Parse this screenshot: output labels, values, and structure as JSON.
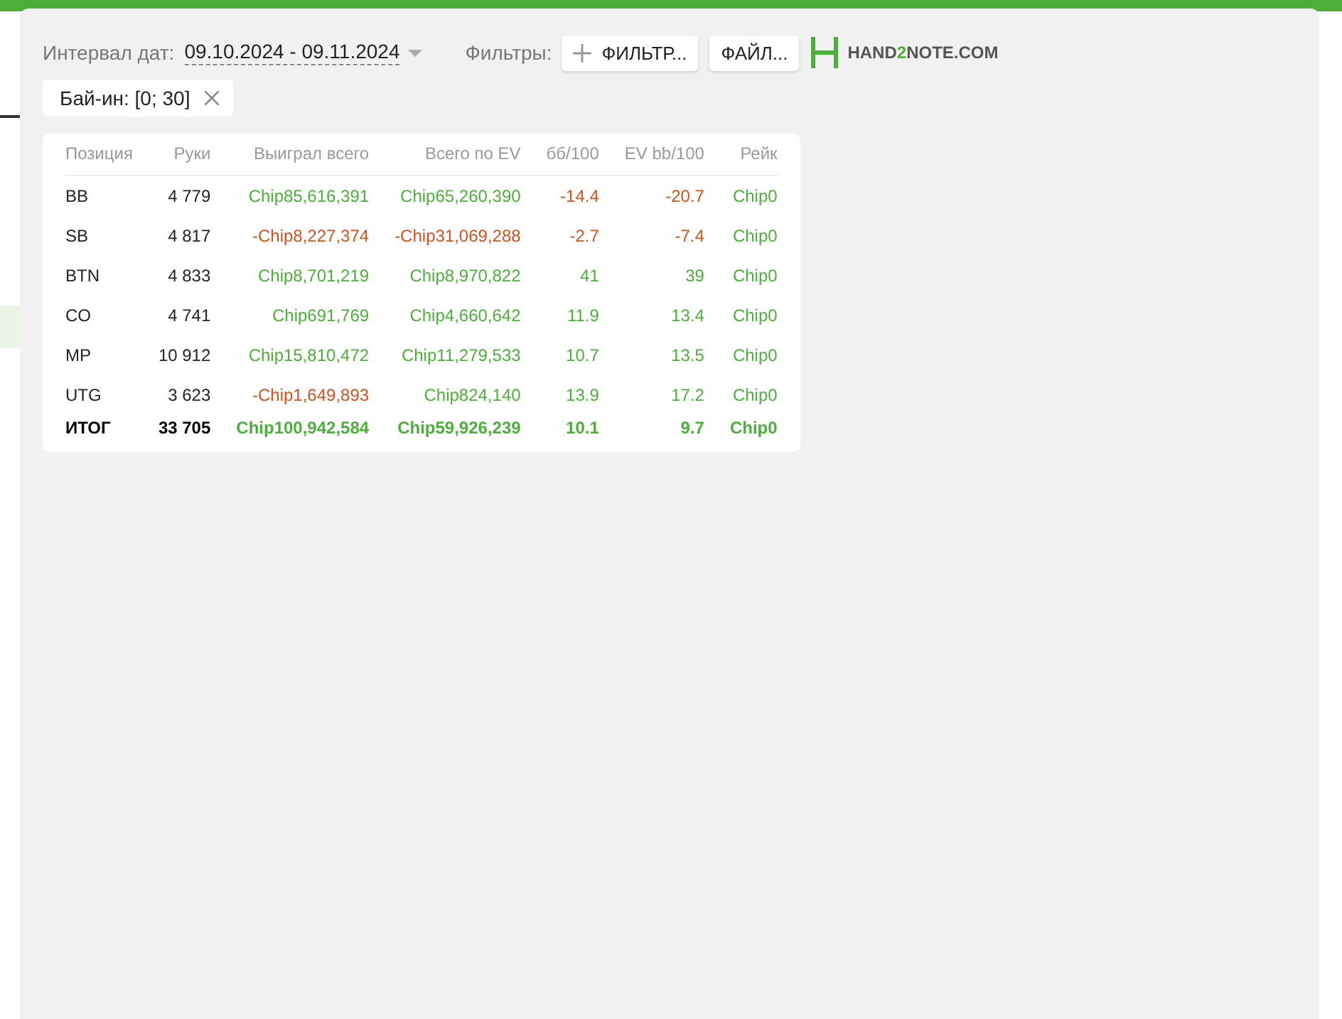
{
  "toolbar": {
    "date_label": "Интервал дат:",
    "date_range": "09.10.2024 - 09.11.2024",
    "filters_label": "Фильтры:",
    "filter_button": "ФИЛЬТР...",
    "file_button": "ФАЙЛ...",
    "logo_parts": [
      {
        "text": "HAND",
        "accent": false
      },
      {
        "text": "2",
        "accent": true
      },
      {
        "text": "NOTE.COM",
        "accent": false
      }
    ]
  },
  "chips": [
    {
      "label": "Бай-ин: [0; 30]"
    }
  ],
  "table": {
    "columns": [
      "Позиция",
      "Руки",
      "Выиграл всего",
      "Всего по EV",
      "бб/100",
      "EV bb/100",
      "Рейк"
    ],
    "rows": [
      {
        "total": false,
        "cells": [
          {
            "text": "BB",
            "color": "#222222"
          },
          {
            "text": "4 779",
            "color": "#222222"
          },
          {
            "text": "Chip85,616,391",
            "color": "#4caf3a"
          },
          {
            "text": "Chip65,260,390",
            "color": "#4caf3a"
          },
          {
            "text": "-14.4",
            "color": "#d2521e"
          },
          {
            "text": "-20.7",
            "color": "#d2521e"
          },
          {
            "text": "Chip0",
            "color": "#4caf3a"
          }
        ]
      },
      {
        "total": false,
        "cells": [
          {
            "text": "SB",
            "color": "#222222"
          },
          {
            "text": "4 817",
            "color": "#222222"
          },
          {
            "text": "-Chip8,227,374",
            "color": "#d2521e"
          },
          {
            "text": "-Chip31,069,288",
            "color": "#d2521e"
          },
          {
            "text": "-2.7",
            "color": "#d2521e"
          },
          {
            "text": "-7.4",
            "color": "#d2521e"
          },
          {
            "text": "Chip0",
            "color": "#4caf3a"
          }
        ]
      },
      {
        "total": false,
        "cells": [
          {
            "text": "BTN",
            "color": "#222222"
          },
          {
            "text": "4 833",
            "color": "#222222"
          },
          {
            "text": "Chip8,701,219",
            "color": "#4caf3a"
          },
          {
            "text": "Chip8,970,822",
            "color": "#4caf3a"
          },
          {
            "text": "41",
            "color": "#4caf3a"
          },
          {
            "text": "39",
            "color": "#4caf3a"
          },
          {
            "text": "Chip0",
            "color": "#4caf3a"
          }
        ]
      },
      {
        "total": false,
        "cells": [
          {
            "text": "CO",
            "color": "#222222"
          },
          {
            "text": "4 741",
            "color": "#222222"
          },
          {
            "text": "Chip691,769",
            "color": "#4caf3a"
          },
          {
            "text": "Chip4,660,642",
            "color": "#4caf3a"
          },
          {
            "text": "11.9",
            "color": "#4caf3a"
          },
          {
            "text": "13.4",
            "color": "#4caf3a"
          },
          {
            "text": "Chip0",
            "color": "#4caf3a"
          }
        ]
      },
      {
        "total": false,
        "cells": [
          {
            "text": "MP",
            "color": "#222222"
          },
          {
            "text": "10 912",
            "color": "#222222"
          },
          {
            "text": "Chip15,810,472",
            "color": "#4caf3a"
          },
          {
            "text": "Chip11,279,533",
            "color": "#4caf3a"
          },
          {
            "text": "10.7",
            "color": "#4caf3a"
          },
          {
            "text": "13.5",
            "color": "#4caf3a"
          },
          {
            "text": "Chip0",
            "color": "#4caf3a"
          }
        ]
      },
      {
        "total": false,
        "cells": [
          {
            "text": "UTG",
            "color": "#222222"
          },
          {
            "text": "3 623",
            "color": "#222222"
          },
          {
            "text": "-Chip1,649,893",
            "color": "#d2521e"
          },
          {
            "text": "Chip824,140",
            "color": "#4caf3a"
          },
          {
            "text": "13.9",
            "color": "#4caf3a"
          },
          {
            "text": "17.2",
            "color": "#4caf3a"
          },
          {
            "text": "Chip0",
            "color": "#4caf3a"
          }
        ]
      },
      {
        "total": true,
        "cells": [
          {
            "text": "ИТОГ",
            "color": "#000000"
          },
          {
            "text": "33 705",
            "color": "#000000"
          },
          {
            "text": "Chip100,942,584",
            "color": "#4caf3a"
          },
          {
            "text": "Chip59,926,239",
            "color": "#4caf3a"
          },
          {
            "text": "10.1",
            "color": "#4caf3a"
          },
          {
            "text": "9.7",
            "color": "#4caf3a"
          },
          {
            "text": "Chip0",
            "color": "#4caf3a"
          }
        ]
      }
    ]
  }
}
